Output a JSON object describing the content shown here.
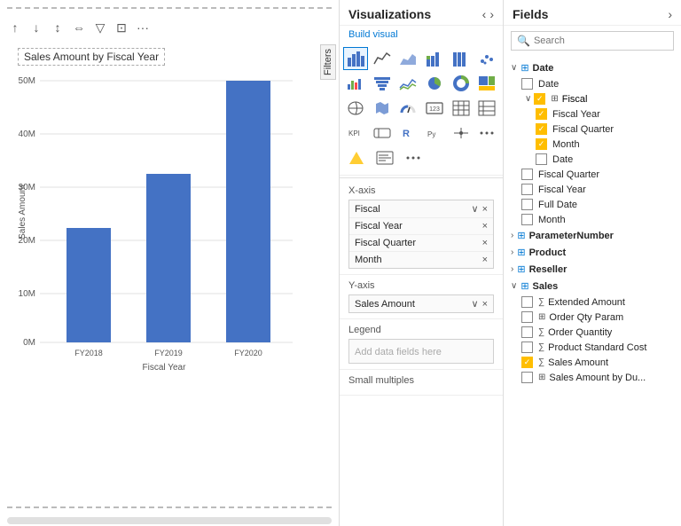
{
  "visualizations": {
    "title": "Visualizations",
    "build_visual_label": "Build visual",
    "filters_label": "Filters",
    "x_axis_label": "X-axis",
    "y_axis_label": "Y-axis",
    "legend_label": "Legend",
    "small_multiples_label": "Small multiples",
    "x_axis_pills": [
      {
        "name": "Fiscal",
        "removable": true
      },
      {
        "name": "Fiscal Year",
        "removable": true
      },
      {
        "name": "Fiscal Quarter",
        "removable": true
      },
      {
        "name": "Month",
        "removable": true
      }
    ],
    "y_axis_pills": [
      {
        "name": "Sales Amount",
        "removable": true
      }
    ],
    "legend_placeholder": "Add data fields here"
  },
  "fields": {
    "title": "Fields",
    "search_placeholder": "Search",
    "groups": [
      {
        "name": "Date",
        "expanded": true,
        "icon": "table",
        "items": [
          {
            "label": "Date",
            "checked": false,
            "icon": "none"
          },
          {
            "label": "Fiscal",
            "checked": true,
            "is_subgroup": true,
            "expanded": true,
            "subitems": [
              {
                "label": "Fiscal Year",
                "checked": true,
                "icon": "none"
              },
              {
                "label": "Fiscal Quarter",
                "checked": true,
                "icon": "none"
              },
              {
                "label": "Month",
                "checked": true,
                "icon": "none"
              },
              {
                "label": "Date",
                "checked": false,
                "icon": "none"
              }
            ]
          },
          {
            "label": "Fiscal Quarter",
            "checked": false,
            "icon": "none"
          },
          {
            "label": "Fiscal Year",
            "checked": false,
            "icon": "none"
          },
          {
            "label": "Full Date",
            "checked": false,
            "icon": "none"
          },
          {
            "label": "Month",
            "checked": false,
            "icon": "none"
          }
        ]
      },
      {
        "name": "ParameterNumber",
        "expanded": false,
        "icon": "table",
        "items": []
      },
      {
        "name": "Product",
        "expanded": false,
        "icon": "table",
        "items": []
      },
      {
        "name": "Reseller",
        "expanded": false,
        "icon": "table",
        "items": []
      },
      {
        "name": "Sales",
        "expanded": true,
        "icon": "table",
        "items": [
          {
            "label": "Extended Amount",
            "checked": false,
            "icon": "sigma"
          },
          {
            "label": "Order Qty Param",
            "checked": false,
            "icon": "table"
          },
          {
            "label": "Order Quantity",
            "checked": false,
            "icon": "sigma"
          },
          {
            "label": "Product Standard Cost",
            "checked": false,
            "icon": "sigma"
          },
          {
            "label": "Sales Amount",
            "checked": true,
            "icon": "sigma"
          },
          {
            "label": "Sales Amount by Du...",
            "checked": false,
            "icon": "table"
          }
        ]
      }
    ]
  },
  "chart": {
    "title": "Sales Amount by Fiscal Year",
    "y_axis_label": "Sales Amount",
    "x_axis_label": "Fiscal Year",
    "bars": [
      {
        "label": "FY2018",
        "height_pct": 42
      },
      {
        "label": "FY2019",
        "height_pct": 62
      },
      {
        "label": "FY2020",
        "height_pct": 100
      }
    ],
    "y_ticks": [
      "50M",
      "40M",
      "30M",
      "20M",
      "10M",
      "0M"
    ]
  }
}
